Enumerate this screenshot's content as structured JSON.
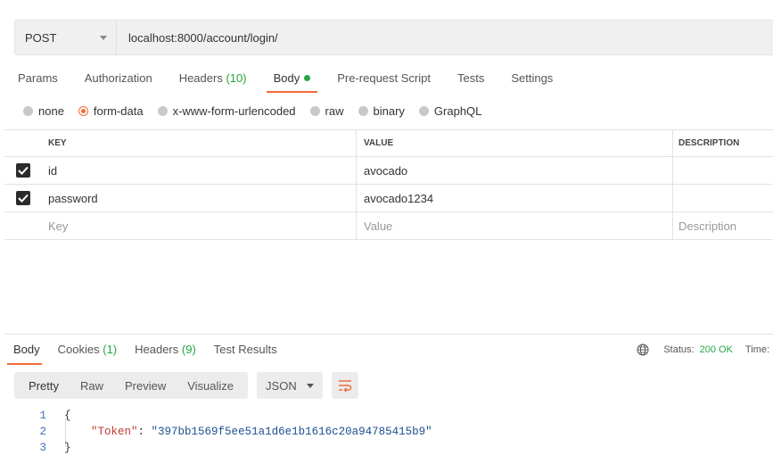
{
  "request": {
    "method": "POST",
    "url": "localhost:8000/account/login/"
  },
  "request_tabs": [
    {
      "label": "Params"
    },
    {
      "label": "Authorization"
    },
    {
      "label": "Headers",
      "count": "(10)"
    },
    {
      "label": "Body"
    },
    {
      "label": "Pre-request Script"
    },
    {
      "label": "Tests"
    },
    {
      "label": "Settings"
    }
  ],
  "body_types": [
    {
      "label": "none"
    },
    {
      "label": "form-data"
    },
    {
      "label": "x-www-form-urlencoded"
    },
    {
      "label": "raw"
    },
    {
      "label": "binary"
    },
    {
      "label": "GraphQL"
    }
  ],
  "selected_body_type": "form-data",
  "form_table": {
    "headers": {
      "key": "KEY",
      "value": "VALUE",
      "description": "DESCRIPTION"
    },
    "rows": [
      {
        "key": "id",
        "value": "avocado",
        "description": "",
        "checked": true
      },
      {
        "key": "password",
        "value": "avocado1234",
        "description": "",
        "checked": true
      }
    ],
    "placeholders": {
      "key": "Key",
      "value": "Value",
      "description": "Description"
    }
  },
  "response_tabs": [
    {
      "label": "Body"
    },
    {
      "label": "Cookies",
      "count": "(1)"
    },
    {
      "label": "Headers",
      "count": "(9)"
    },
    {
      "label": "Test Results"
    }
  ],
  "response_meta": {
    "status_label": "Status:",
    "status_value": "200 OK",
    "time_label": "Time:"
  },
  "view_modes": [
    {
      "label": "Pretty"
    },
    {
      "label": "Raw"
    },
    {
      "label": "Preview"
    },
    {
      "label": "Visualize"
    }
  ],
  "format": "JSON",
  "response_body": {
    "line_numbers": [
      "1",
      "2",
      "3"
    ],
    "open_brace": "{",
    "json_key": "\"Token\"",
    "colon": ": ",
    "json_value": "\"397bb1569f5ee51a1d6e1b1616c20a94785415b9\"",
    "close_brace": "}"
  },
  "colors": {
    "accent": "#f26b3a",
    "success": "#26a642"
  }
}
